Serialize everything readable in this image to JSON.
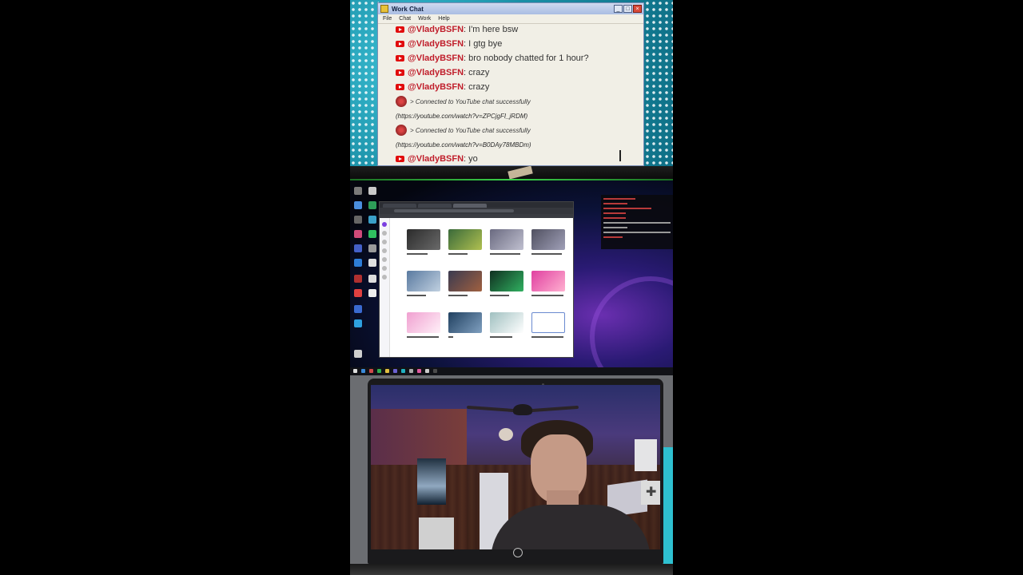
{
  "chat_window": {
    "title": "Work Chat",
    "menu": [
      "File",
      "Chat",
      "Work",
      "Help"
    ],
    "messages": [
      {
        "kind": "user",
        "user": "@VladyBSFN",
        "text": ": I'm here bsw"
      },
      {
        "kind": "user",
        "user": "@VladyBSFN",
        "text": ": I gtg bye"
      },
      {
        "kind": "user",
        "user": "@VladyBSFN",
        "text": ": bro nobody chatted for 1 hour?"
      },
      {
        "kind": "user",
        "user": "@VladyBSFN",
        "text": ": crazy"
      },
      {
        "kind": "user",
        "user": "@VladyBSFN",
        "text": ": crazy"
      },
      {
        "kind": "system",
        "text": "> Connected to YouTube chat successfully",
        "link": "(https://youtube.com/watch?v=ZPCjgFI_jRDM)"
      },
      {
        "kind": "system",
        "text": "> Connected to YouTube chat successfully",
        "link": "(https://youtube.com/watch?v=B0DAy78MBDm)"
      },
      {
        "kind": "user",
        "user": "@VladyBSFN",
        "text": ": yo"
      }
    ]
  },
  "colors": {
    "teal_bg": "#1a8fa6",
    "youtube_red": "#e10c0c",
    "username": "#c01d2a",
    "window_bg": "#f1efe6"
  },
  "icons": [
    "youtube-icon",
    "minimize-icon",
    "maximize-icon",
    "close-icon",
    "app-icon"
  ]
}
